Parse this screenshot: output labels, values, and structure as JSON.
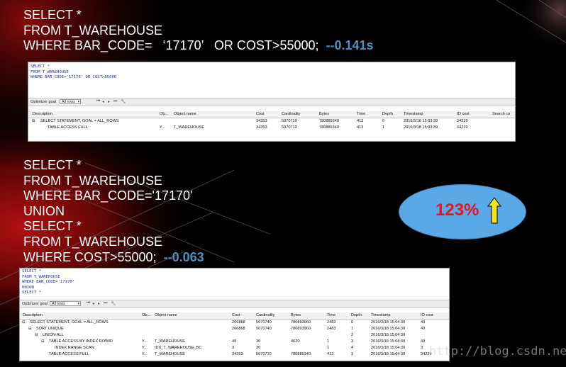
{
  "query1": {
    "lines": [
      "SELECT *",
      "FROM T_WAREHOUSE"
    ],
    "where_line": "WHERE BAR_CODE=   ‘17170’   OR COST>55000;",
    "timing": "--0.141s"
  },
  "panel1": {
    "code_lines": [
      "SELECT *",
      "FROM T_WAREHOUSE",
      "WHERE BAR_CODE='17170' OR COST>55000"
    ],
    "toolbar": {
      "label": "Optimizer goal",
      "value": "All rows"
    },
    "columns": [
      "Description",
      "Ob...",
      "Object name",
      "Cost",
      "Cardinality",
      "Bytes",
      "Time",
      "Depth",
      "Timestamp",
      "IO cost",
      "Search co"
    ],
    "rows": [
      [
        "SELECT STATEMENT, GOAL = ALL_ROWS",
        "",
        "",
        "34353",
        "5070710",
        "780889340",
        "413",
        "0",
        "2016/3/18 15:03:39",
        "34229"
      ],
      [
        "TABLE ACCESS FULL",
        "Y...",
        "T_WAREHOUSE",
        "34353",
        "5070710",
        "780889340",
        "413",
        "1",
        "2016/3/18 15:03:39",
        "34229"
      ]
    ]
  },
  "query2": {
    "lines": [
      "SELECT *",
      "FROM T_WAREHOUSE",
      "WHERE BAR_CODE='17170'",
      "UNION",
      "SELECT *",
      "FROM T_WAREHOUSE"
    ],
    "where_line": "WHERE COST>55000;",
    "timing": "--0.063"
  },
  "panel2": {
    "code_lines": [
      "SELECT *",
      "FROM T_WAREHOUSE",
      "WHERE BAR_CODE='17170'",
      "UNION",
      "SELECT *"
    ],
    "toolbar": {
      "label": "Optimizer goal",
      "value": "All rows"
    },
    "columns": [
      "Description",
      "Ob...",
      "Object name",
      "Cost",
      "Cardinality",
      "Bytes",
      "Time",
      "Depth",
      "Timestamp",
      "IO cost"
    ],
    "rows": [
      [
        "SELECT STATEMENT, GOAL = ALL_ROWS",
        "",
        "",
        "206868",
        "5070740",
        "780893960",
        "2483",
        "0",
        "2016/3/18 15:04:30",
        "49"
      ],
      [
        "SORT UNIQUE",
        "",
        "",
        "206868",
        "5070740",
        "780893960",
        "2483",
        "1",
        "2016/3/18 15:04:30",
        "49"
      ],
      [
        "UNION-ALL",
        "",
        "",
        "",
        "",
        "",
        "",
        "2",
        "2016/3/18 15:04:30",
        ""
      ],
      [
        "TABLE ACCESS BY INDEX ROWID",
        "Y...",
        "T_WAREHOUSE",
        "49",
        "30",
        "4620",
        "1",
        "3",
        "2016/3/18 15:04:30",
        "49"
      ],
      [
        "INDEX RANGE SCAN",
        "Y...",
        "IDX_T_WAREHOUSE_BC",
        "3",
        "30",
        "",
        "1",
        "4",
        "2016/3/18 15:04:30",
        "3"
      ],
      [
        "TABLE ACCESS FULL",
        "Y...",
        "T_WAREHOUSE",
        "34353",
        "5070710",
        "780889340",
        "413",
        "3",
        "2016/3/18 15:04:30",
        "34229"
      ]
    ]
  },
  "badge": {
    "percent": "123%",
    "arrow_color": "#f4e61e",
    "ellipse_color": "#5aa9e6"
  },
  "watermark": "http://blog.csdn.net/"
}
